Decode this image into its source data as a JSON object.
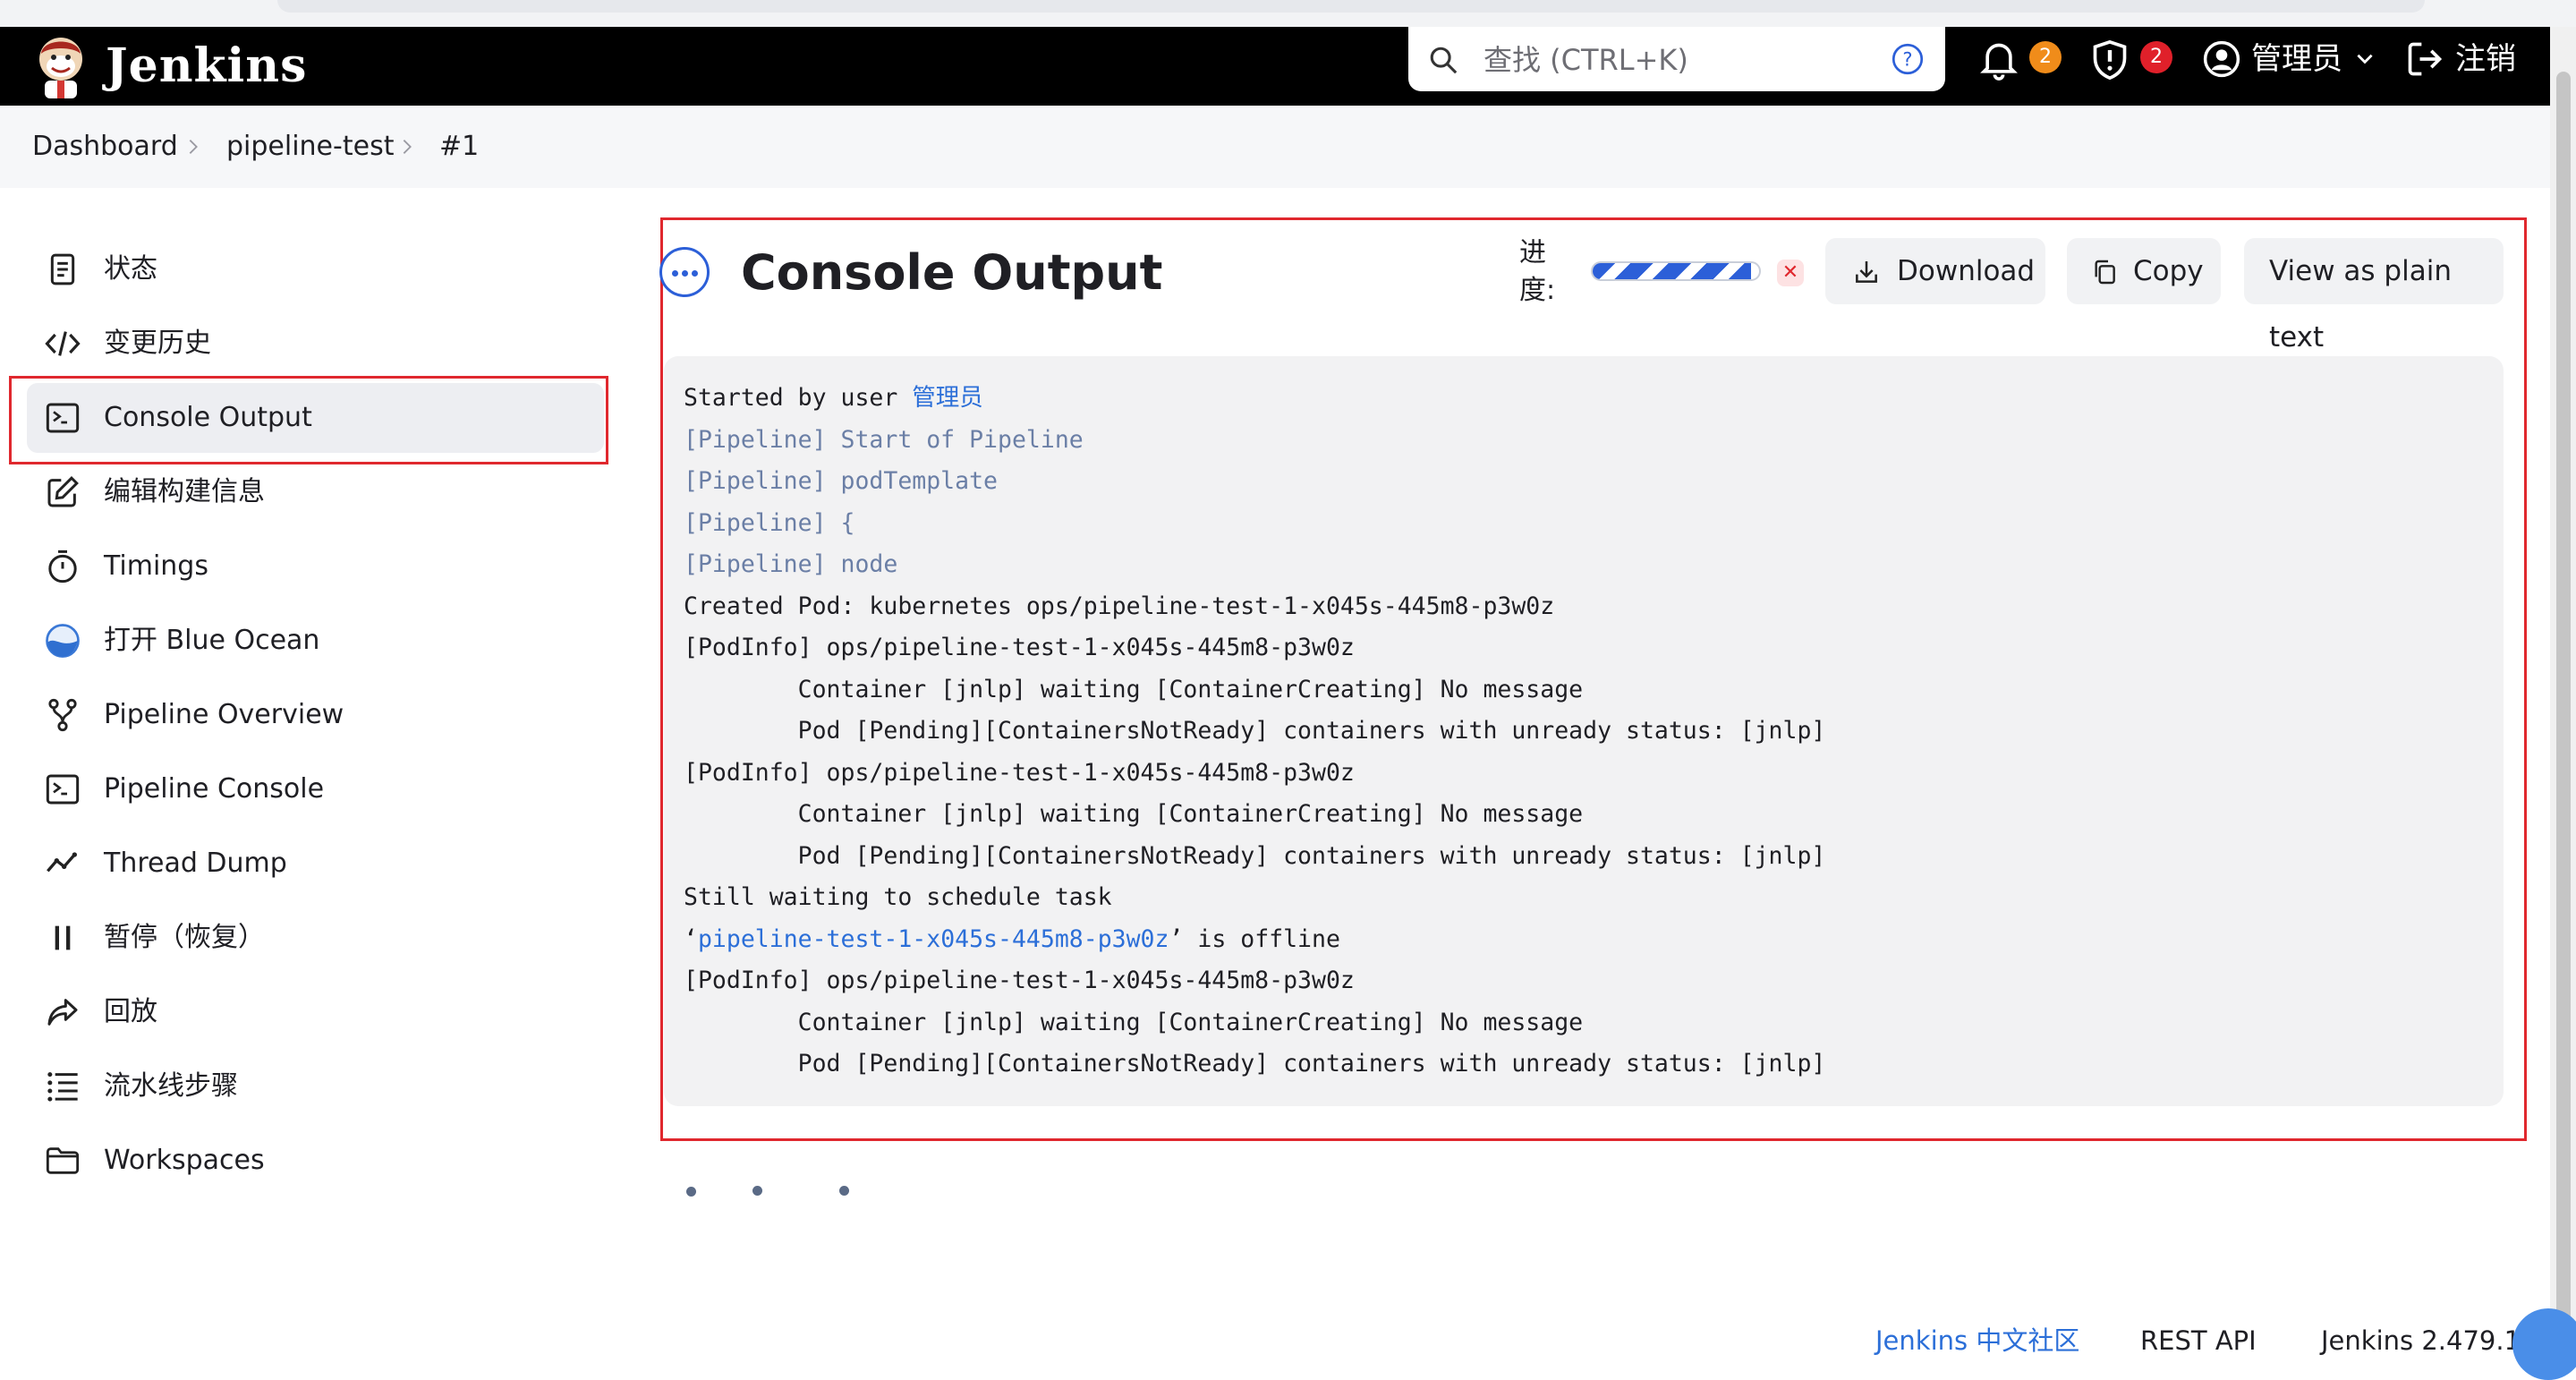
{
  "header": {
    "brand": "Jenkins",
    "search_placeholder": "查找 (CTRL+K)",
    "notifications_count": "2",
    "security_count": "2",
    "user": "管理员",
    "logout": "注销",
    "colors": {
      "bar": "#000000",
      "notif_badge": "#f08c1a",
      "security_badge": "#e0202a"
    }
  },
  "breadcrumb": [
    "Dashboard",
    "pipeline-test",
    "#1"
  ],
  "sidebar": {
    "items": [
      {
        "label": "状态",
        "icon": "document-icon"
      },
      {
        "label": "变更历史",
        "icon": "code-icon"
      },
      {
        "label": "Console Output",
        "icon": "terminal-icon",
        "active": true
      },
      {
        "label": "编辑构建信息",
        "icon": "edit-icon"
      },
      {
        "label": "Timings",
        "icon": "stopwatch-icon"
      },
      {
        "label": "打开 Blue Ocean",
        "icon": "blue-ocean-icon"
      },
      {
        "label": "Pipeline Overview",
        "icon": "branch-icon"
      },
      {
        "label": "Pipeline Console",
        "icon": "terminal-icon"
      },
      {
        "label": "Thread Dump",
        "icon": "activity-icon"
      },
      {
        "label": "暂停（恢复）",
        "icon": "pause-icon"
      },
      {
        "label": "回放",
        "icon": "replay-icon"
      },
      {
        "label": "流水线步骤",
        "icon": "list-icon"
      },
      {
        "label": "Workspaces",
        "icon": "folder-icon"
      }
    ]
  },
  "main": {
    "title": "Console Output",
    "progress_label": "进度:",
    "progress_fraction": 0.95,
    "buttons": {
      "download": "Download",
      "copy": "Copy",
      "plain": "View as plain text"
    },
    "console": {
      "l1_pre": "Started by user ",
      "l1_user": "管理员",
      "l2": "[Pipeline] Start of Pipeline",
      "l3": "[Pipeline] podTemplate",
      "l4": "[Pipeline] {",
      "l5": "[Pipeline] node",
      "l6": "Created Pod: kubernetes ops/pipeline-test-1-x045s-445m8-p3w0z",
      "l7": "[PodInfo] ops/pipeline-test-1-x045s-445m8-p3w0z",
      "l8": "\tContainer [jnlp] waiting [ContainerCreating] No message",
      "l9": "\tPod [Pending][ContainersNotReady] containers with unready status: [jnlp]",
      "l10": "[PodInfo] ops/pipeline-test-1-x045s-445m8-p3w0z",
      "l11": "\tContainer [jnlp] waiting [ContainerCreating] No message",
      "l12": "\tPod [Pending][ContainersNotReady] containers with unready status: [jnlp]",
      "l13": "Still waiting to schedule task",
      "l14_open": "‘",
      "l14_link": "pipeline-test-1-x045s-445m8-p3w0z",
      "l14_rest": "’ is offline",
      "l15": "[PodInfo] ops/pipeline-test-1-x045s-445m8-p3w0z",
      "l16": "\tContainer [jnlp] waiting [ContainerCreating] No message",
      "l17": "\tPod [Pending][ContainersNotReady] containers with unready status: [jnlp]"
    }
  },
  "footer": {
    "community": "Jenkins 中文社区",
    "rest_api": "REST API",
    "version": "Jenkins 2.479.1"
  }
}
